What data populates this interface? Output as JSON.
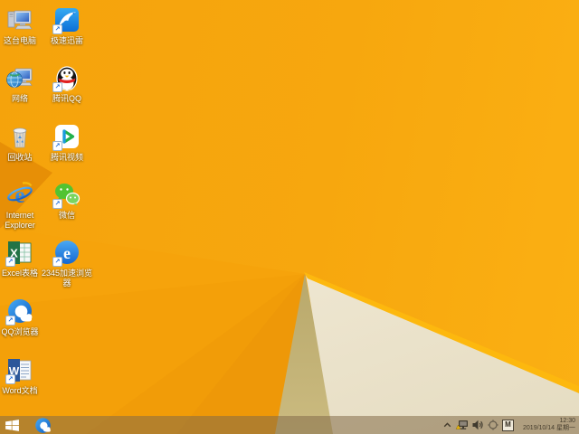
{
  "desktop": {
    "icons": [
      {
        "name": "this-pc",
        "label": "这台电脑"
      },
      {
        "name": "xunlei-speed",
        "label": "极速迅雷"
      },
      {
        "name": "network",
        "label": "网络"
      },
      {
        "name": "tencent-qq",
        "label": "腾讯QQ"
      },
      {
        "name": "recycle-bin",
        "label": "回收站"
      },
      {
        "name": "tencent-video",
        "label": "腾讯视频"
      },
      {
        "name": "internet-explorer",
        "label": "Internet Explorer"
      },
      {
        "name": "wechat",
        "label": "微信"
      },
      {
        "name": "excel",
        "label": "Excel表格"
      },
      {
        "name": "2345-browser",
        "label": "2345加速浏览器"
      },
      {
        "name": "qq-browser",
        "label": "QQ浏览器"
      },
      {
        "name": "word",
        "label": "Word文档"
      }
    ]
  },
  "taskbar": {
    "tray": {
      "ime_indicator": "M",
      "icons": [
        "hidden-icons-chevron",
        "network-warning",
        "volume",
        "action-target"
      ]
    },
    "clock": {
      "time": "12:30",
      "date": "2019/10/14 星期一"
    }
  },
  "colors": {
    "wallpaper_orange": "#f7a70e",
    "wallpaper_dark_fold": "#e78f06",
    "wallpaper_tan": "#b5a466",
    "wallpaper_cream": "#efe7d2",
    "wallpaper_ridge": "#fdb80e",
    "taskbar_tint": "rgba(132,108,73,0.55)",
    "icon_label_text": "#ffffff",
    "tray_text": "#463d2e"
  }
}
